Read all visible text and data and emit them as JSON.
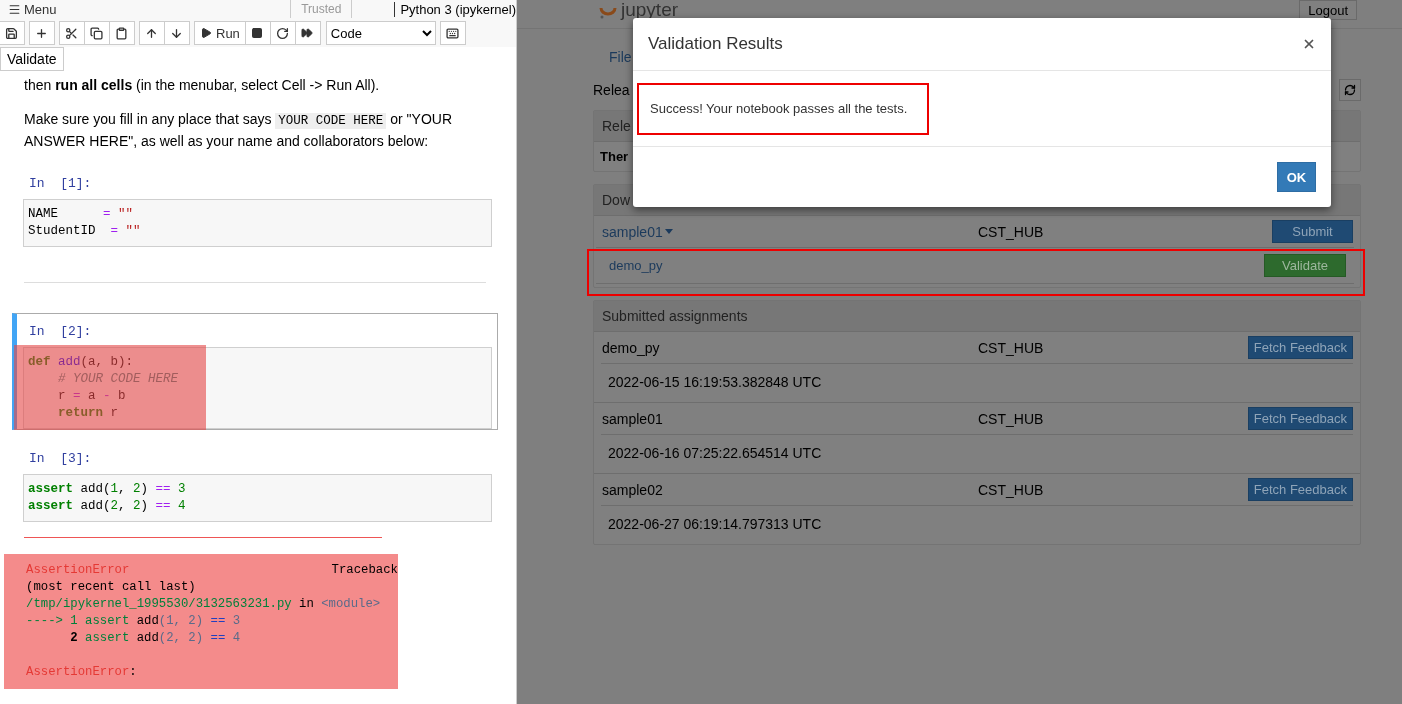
{
  "notebook": {
    "menu_label": "Menu",
    "trusted": "Trusted",
    "kernel": "Python 3 (ipykernel)",
    "run_label": "Run",
    "cell_type": "Code",
    "validate_button": "Validate",
    "intro": [
      [
        {
          "kind": "text",
          "t": "then "
        },
        {
          "kind": "bold",
          "t": "run all cells"
        },
        {
          "kind": "text",
          "t": " (in the menubar, select Cell -> Run All)."
        }
      ],
      [
        {
          "kind": "text",
          "t": "Make sure you fill in any place that says "
        },
        {
          "kind": "code",
          "t": "YOUR CODE HERE"
        },
        {
          "kind": "text",
          "t": " or \"YOUR ANSWER HERE\", as well as your name and collaborators below:"
        }
      ]
    ],
    "cells": [
      {
        "prompt": "In  [1]:",
        "selected": false,
        "highlighted": false,
        "lines": [
          [
            {
              "kind": "plain",
              "t": "NAME      "
            },
            {
              "kind": "op",
              "t": "="
            },
            {
              "kind": "str",
              "t": " \"\""
            }
          ],
          [
            {
              "kind": "plain",
              "t": "StudentID  "
            },
            {
              "kind": "op",
              "t": "="
            },
            {
              "kind": "str",
              "t": " \"\""
            }
          ]
        ]
      },
      {
        "prompt": "In  [2]:",
        "selected": true,
        "highlighted": true,
        "lines": [
          [
            {
              "kind": "kw",
              "t": "def"
            },
            {
              "kind": "def",
              "t": " add"
            },
            {
              "kind": "plain",
              "t": "(a, b):"
            }
          ],
          [
            {
              "kind": "comment",
              "t": "    # YOUR CODE HERE"
            }
          ],
          [
            {
              "kind": "plain",
              "t": "    r "
            },
            {
              "kind": "op",
              "t": "="
            },
            {
              "kind": "plain",
              "t": " a "
            },
            {
              "kind": "op",
              "t": "-"
            },
            {
              "kind": "plain",
              "t": " b"
            }
          ],
          [
            {
              "kind": "kw",
              "t": "    return"
            },
            {
              "kind": "plain",
              "t": " r"
            }
          ]
        ]
      },
      {
        "prompt": "In  [3]:",
        "selected": false,
        "highlighted": false,
        "lines": [
          [
            {
              "kind": "kw",
              "t": "assert"
            },
            {
              "kind": "plain",
              "t": " add("
            },
            {
              "kind": "num",
              "t": "1"
            },
            {
              "kind": "plain",
              "t": ", "
            },
            {
              "kind": "num",
              "t": "2"
            },
            {
              "kind": "plain",
              "t": ") "
            },
            {
              "kind": "op",
              "t": "=="
            },
            {
              "kind": "num",
              "t": " 3"
            }
          ],
          [
            {
              "kind": "kw",
              "t": "assert"
            },
            {
              "kind": "plain",
              "t": " add("
            },
            {
              "kind": "num",
              "t": "2"
            },
            {
              "kind": "plain",
              "t": ", "
            },
            {
              "kind": "num",
              "t": "2"
            },
            {
              "kind": "plain",
              "t": ") "
            },
            {
              "kind": "op",
              "t": "=="
            },
            {
              "kind": "num",
              "t": " 4"
            }
          ]
        ]
      }
    ],
    "output": {
      "error": "AssertionError",
      "traceback": "Traceback",
      "lines": [
        [
          {
            "kind": "plain",
            "t": "(most recent call last)"
          }
        ],
        [
          {
            "kind": "path",
            "t": "/tmp/ipykernel_1995530/3132563231.py"
          },
          {
            "kind": "plain",
            "t": " in "
          },
          {
            "kind": "muted",
            "t": "<module>"
          }
        ],
        [
          {
            "kind": "path",
            "t": "----> 1 assert"
          },
          {
            "kind": "plain",
            "t": " add"
          },
          {
            "kind": "muted",
            "t": "(1, 2)"
          },
          {
            "kind": "op2",
            "t": " =="
          },
          {
            "kind": "muted",
            "t": " 3"
          }
        ],
        [
          {
            "kind": "bold",
            "t": "      2"
          },
          {
            "kind": "path",
            "t": " assert"
          },
          {
            "kind": "plain",
            "t": " add"
          },
          {
            "kind": "muted",
            "t": "(2, 2)"
          },
          {
            "kind": "op2",
            "t": " =="
          },
          {
            "kind": "muted",
            "t": " 4"
          }
        ]
      ],
      "final": [
        {
          "kind": "error",
          "t": "AssertionError"
        },
        {
          "kind": "plain",
          "t": ":"
        }
      ]
    }
  },
  "page": {
    "logo": "jupyter",
    "logout": "Logout",
    "tab": "File",
    "released_label": "Relea",
    "released_panel": {
      "header": "Rele",
      "body": "Ther"
    },
    "downloaded": {
      "header": "Dow",
      "assignment": "sample01",
      "course": "CST_HUB",
      "submit": "Submit",
      "notebook": "demo_py",
      "validate": "Validate"
    },
    "submitted": {
      "header": "Submitted assignments",
      "rows": [
        {
          "name": "demo_py",
          "course": "CST_HUB",
          "button": "Fetch Feedback",
          "timestamp": "2022-06-15 16:19:53.382848 UTC"
        },
        {
          "name": "sample01",
          "course": "CST_HUB",
          "button": "Fetch Feedback",
          "timestamp": "2022-06-16 07:25:22.654514 UTC"
        },
        {
          "name": "sample02",
          "course": "CST_HUB",
          "button": "Fetch Feedback",
          "timestamp": "2022-06-27 06:19:14.797313 UTC"
        }
      ]
    }
  },
  "modal": {
    "title": "Validation Results",
    "message": "Success! Your notebook passes all the tests.",
    "ok": "OK"
  }
}
